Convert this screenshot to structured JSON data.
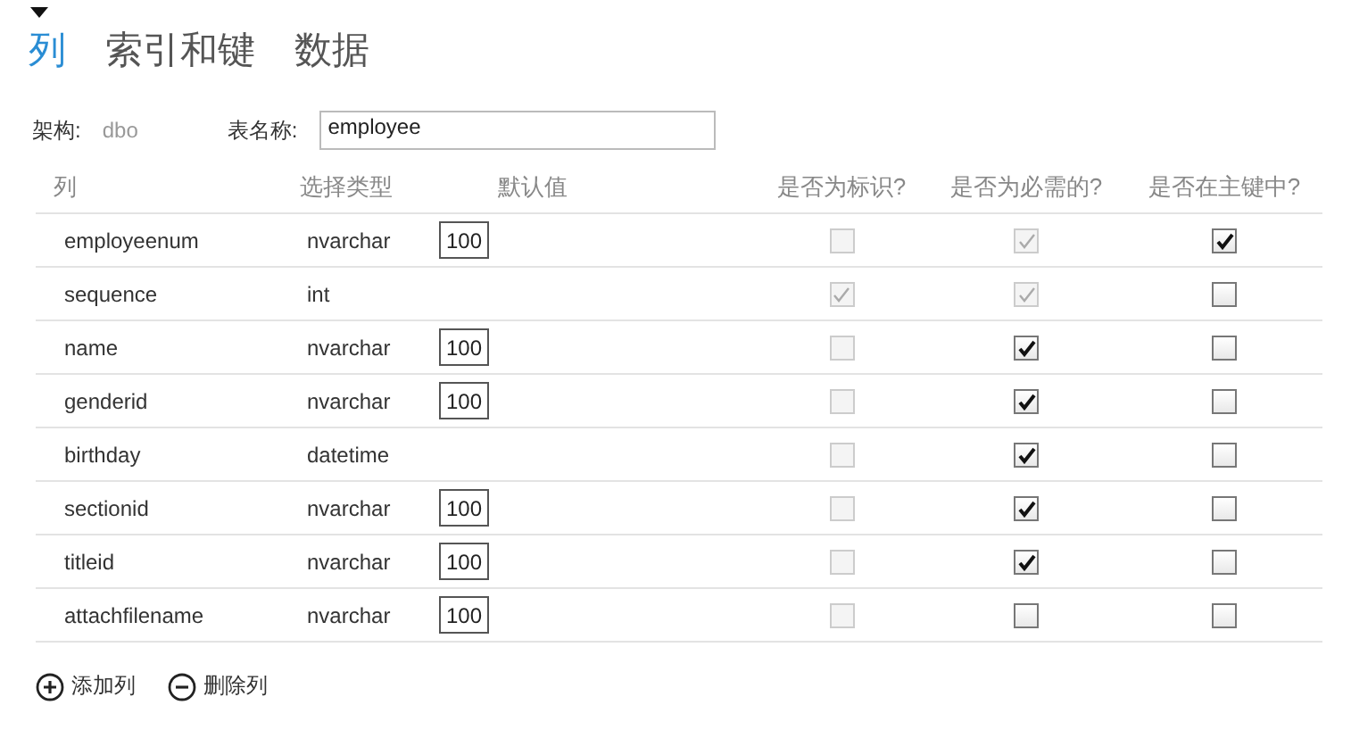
{
  "tabs": [
    {
      "label": "列",
      "selected": true
    },
    {
      "label": "索引和键",
      "selected": false
    },
    {
      "label": "数据",
      "selected": false
    }
  ],
  "schema": {
    "label": "架构:",
    "value": "dbo"
  },
  "table_name": {
    "label": "表名称:",
    "value": "employee"
  },
  "columns": [
    "列",
    "选择类型",
    "默认值",
    "是否为标识?",
    "是否为必需的?",
    "是否在主键中?"
  ],
  "rows": [
    {
      "name": "employeenum",
      "type": "nvarchar",
      "size": "100",
      "identity": {
        "checked": false,
        "disabled": true
      },
      "required": {
        "checked": true,
        "disabled": true
      },
      "primary_key": {
        "checked": true,
        "disabled": false
      }
    },
    {
      "name": "sequence",
      "type": "int",
      "identity": {
        "checked": true,
        "disabled": true
      },
      "required": {
        "checked": true,
        "disabled": true
      },
      "primary_key": {
        "checked": false,
        "disabled": false
      }
    },
    {
      "name": "name",
      "type": "nvarchar",
      "size": "100",
      "identity": {
        "checked": false,
        "disabled": true
      },
      "required": {
        "checked": true,
        "disabled": false
      },
      "primary_key": {
        "checked": false,
        "disabled": false
      }
    },
    {
      "name": "genderid",
      "type": "nvarchar",
      "size": "100",
      "identity": {
        "checked": false,
        "disabled": true
      },
      "required": {
        "checked": true,
        "disabled": false
      },
      "primary_key": {
        "checked": false,
        "disabled": false
      }
    },
    {
      "name": "birthday",
      "type": "datetime",
      "identity": {
        "checked": false,
        "disabled": true
      },
      "required": {
        "checked": true,
        "disabled": false
      },
      "primary_key": {
        "checked": false,
        "disabled": false
      }
    },
    {
      "name": "sectionid",
      "type": "nvarchar",
      "size": "100",
      "identity": {
        "checked": false,
        "disabled": true
      },
      "required": {
        "checked": true,
        "disabled": false
      },
      "primary_key": {
        "checked": false,
        "disabled": false
      }
    },
    {
      "name": "titleid",
      "type": "nvarchar",
      "size": "100",
      "identity": {
        "checked": false,
        "disabled": true
      },
      "required": {
        "checked": true,
        "disabled": false
      },
      "primary_key": {
        "checked": false,
        "disabled": false
      }
    },
    {
      "name": "attachfilename",
      "type": "nvarchar",
      "size": "100",
      "identity": {
        "checked": false,
        "disabled": true
      },
      "required": {
        "checked": false,
        "disabled": false
      },
      "primary_key": {
        "checked": false,
        "disabled": false
      }
    }
  ],
  "actions": [
    {
      "kind": "add",
      "label": "添加列"
    },
    {
      "kind": "remove",
      "label": "删除列"
    }
  ]
}
